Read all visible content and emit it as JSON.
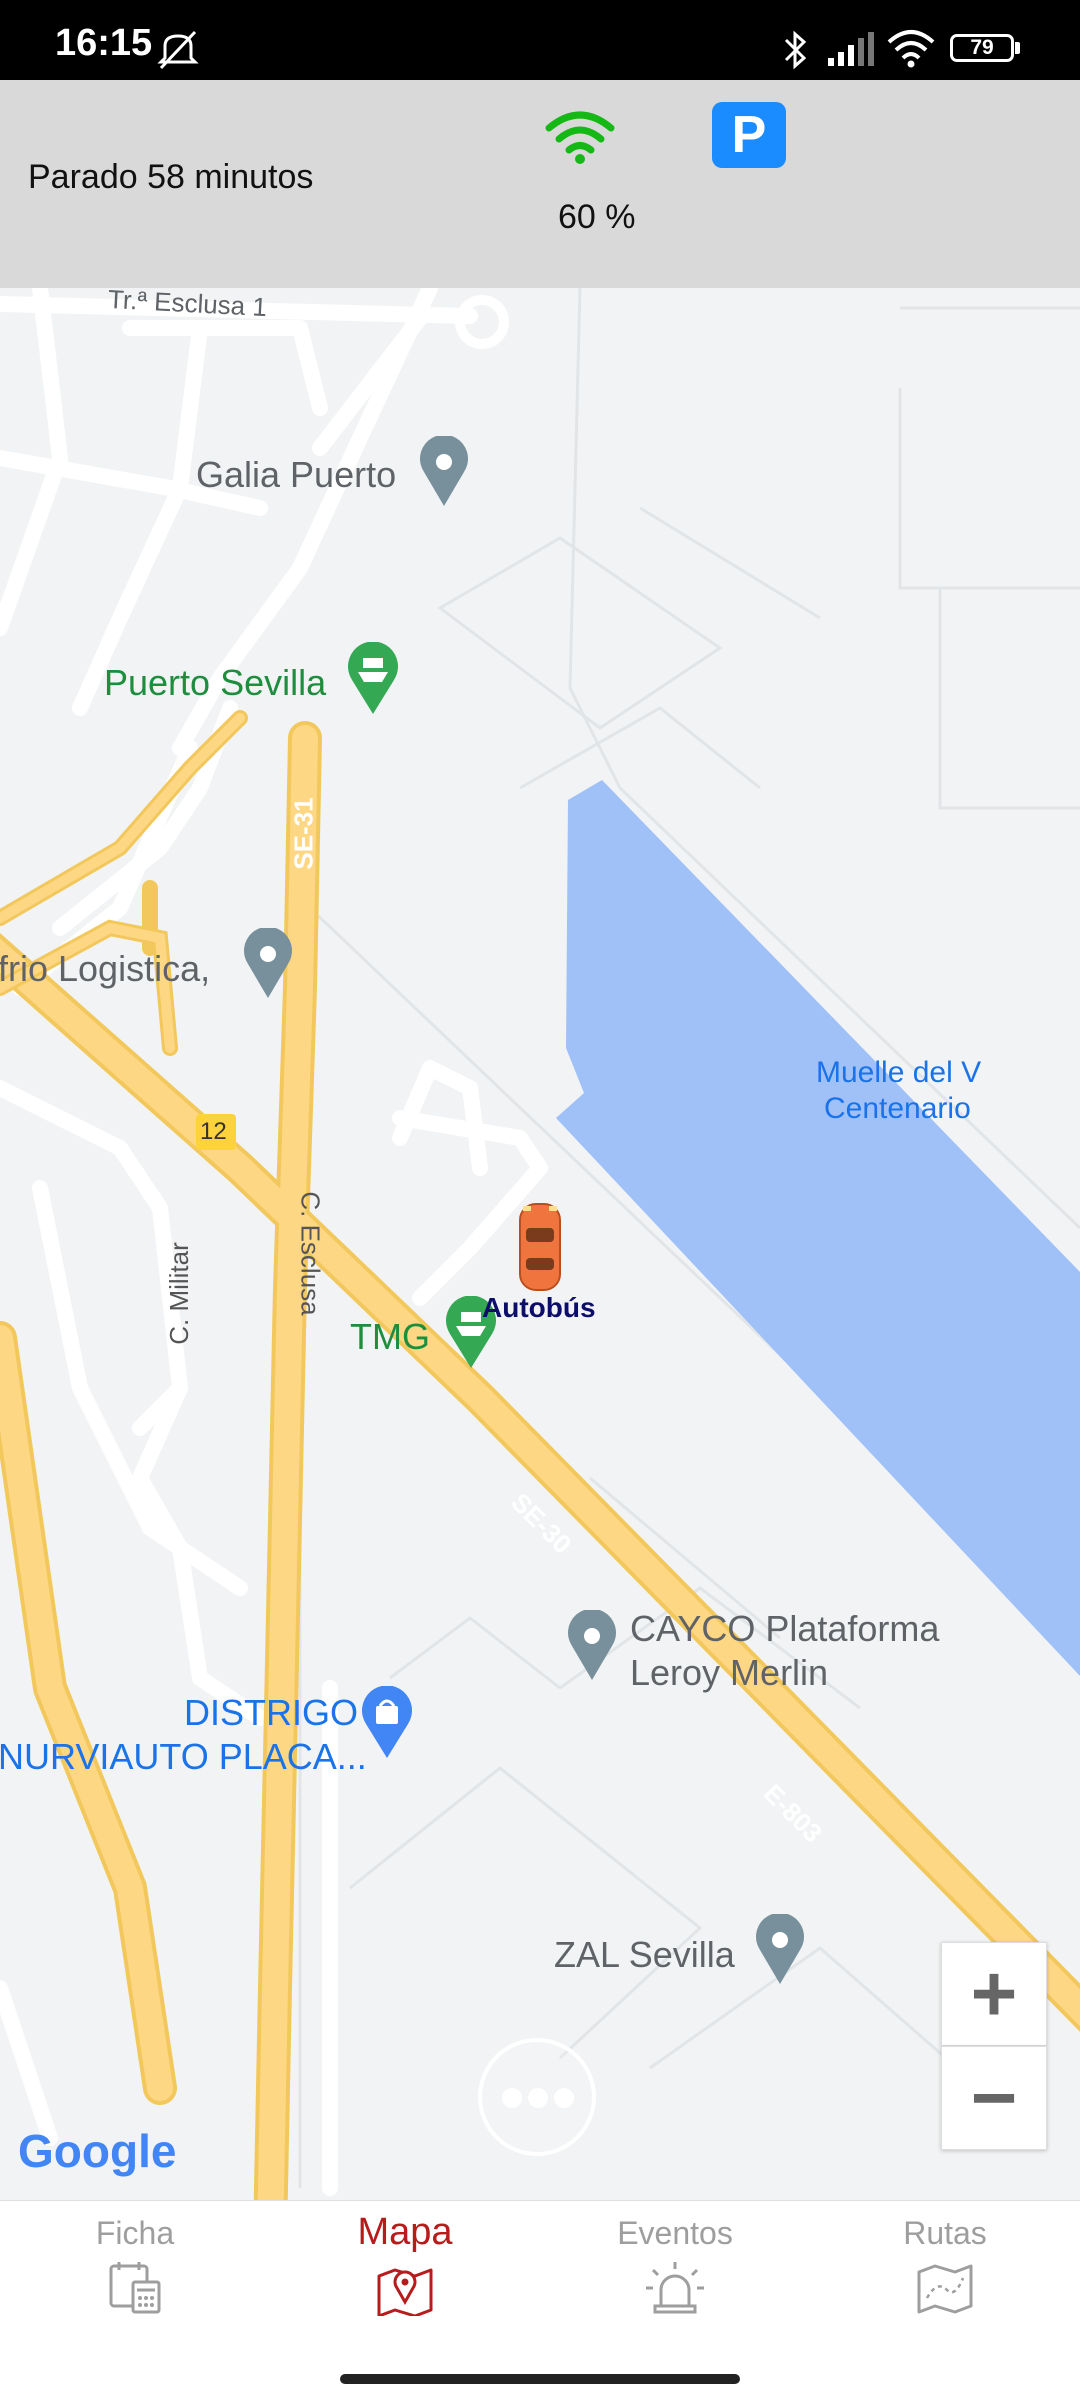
{
  "statusbar": {
    "time": "16:15",
    "battery": "79"
  },
  "infobar": {
    "status_text": "Parado 58 minutos",
    "signal_text": "60 %",
    "parking_label": "P"
  },
  "map": {
    "labels": {
      "esclusa1": "Tr.ª Esclusa 1",
      "galia": "Galia Puerto",
      "puerto": "Puerto Sevilla",
      "frio": "frio Logistica,",
      "muelle_line1": "Muelle del V",
      "muelle_line2": "Centenario",
      "exit12": "12",
      "se31": "SE-31",
      "cesclusa": "C. Esclusa",
      "cmilitar": "C. Militar",
      "tmg": "TMG",
      "vehicle": "Autobús",
      "se30": "SE-30",
      "cayco_line1": "CAYCO Plataforma",
      "cayco_line2": "Leroy Merlin",
      "distrigo": "DISTRIGO",
      "nurviauto": "NURVIAUTO PLACA...",
      "e803": "E-803",
      "zal": "ZAL Sevilla"
    },
    "attribution": "Google",
    "zoom_in": "+",
    "zoom_out": "−"
  },
  "nav": [
    {
      "label": "Ficha",
      "icon": "calendar-calculator-icon"
    },
    {
      "label": "Mapa",
      "icon": "map-pin-icon",
      "active": true
    },
    {
      "label": "Eventos",
      "icon": "alarm-siren-icon"
    },
    {
      "label": "Rutas",
      "icon": "route-map-icon"
    }
  ],
  "colors": {
    "accent": "#b71c1c",
    "water": "#9fc1f8",
    "road": "#fdd784",
    "green_poi": "#1e8e3e",
    "wifi": "#16b816",
    "parking": "#1a8cff"
  }
}
